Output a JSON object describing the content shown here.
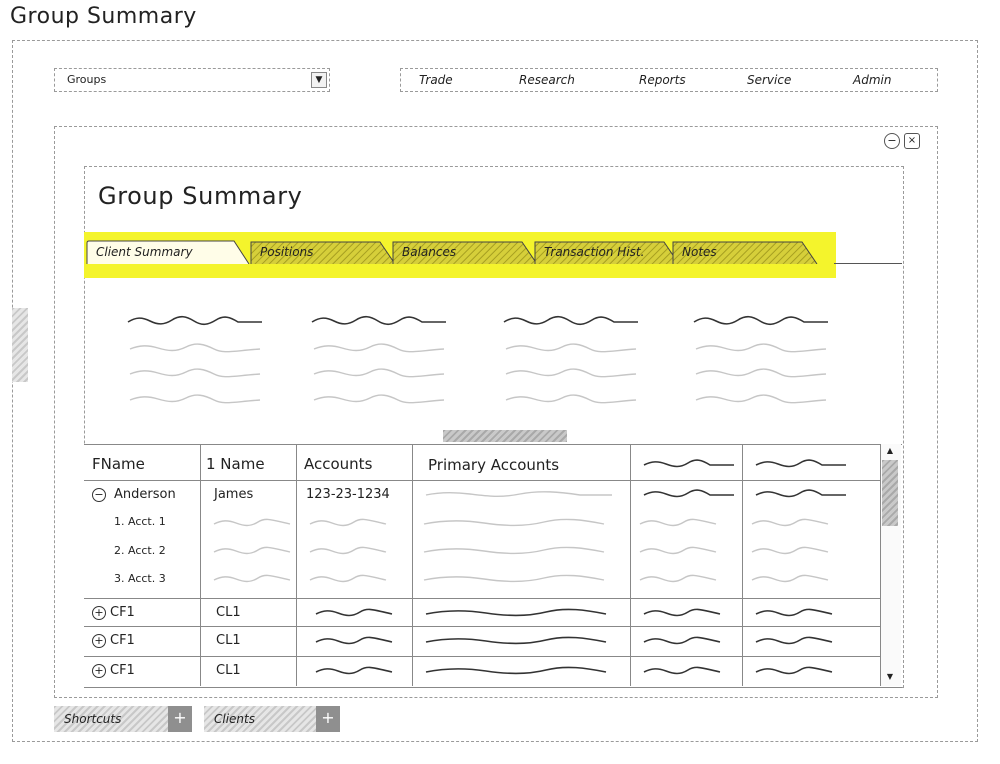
{
  "page": {
    "title": "Group Summary"
  },
  "groups_select": {
    "value": "Groups",
    "arrow": "▼"
  },
  "menu": {
    "items": [
      "Trade",
      "Research",
      "Reports",
      "Service",
      "Admin"
    ]
  },
  "window": {
    "minimize": "−",
    "close": "×"
  },
  "panel": {
    "title": "Group Summary"
  },
  "tabs": [
    "Client Summary",
    "Positions",
    "Balances",
    "Transaction Hist.",
    "Notes"
  ],
  "active_tab": "Client Summary",
  "colors": {
    "highlight": "#f4f42c"
  },
  "grid": {
    "headers": [
      "FName",
      "1 Name",
      "Accounts",
      "Primary Accounts"
    ],
    "expanded_row": {
      "expander": "−",
      "fname": "Anderson",
      "lname": "James",
      "account": "123-23-1234"
    },
    "sub_rows": [
      "1. Acct. 1",
      "2. Acct. 2",
      "3. Acct. 3"
    ],
    "collapsed_rows": [
      {
        "expander": "+",
        "fname": "CF1",
        "lname": "CL1"
      },
      {
        "expander": "+",
        "fname": "CF1",
        "lname": "CL1"
      },
      {
        "expander": "+",
        "fname": "CF1",
        "lname": "CL1"
      }
    ],
    "scroll_up": "▲",
    "scroll_down": "▼"
  },
  "bottom_bar": [
    {
      "label": "Shortcuts",
      "plus": "+"
    },
    {
      "label": "Clients",
      "plus": "+"
    }
  ]
}
